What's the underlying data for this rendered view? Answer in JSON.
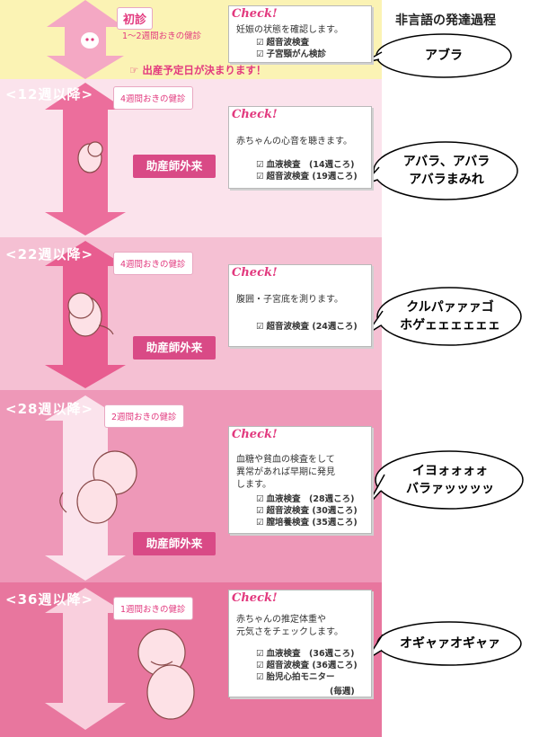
{
  "title": "非言語の発達過程",
  "first": {
    "header": "初診",
    "interval": "1〜2週間おきの健診",
    "due_note": "出産予定日が決まります！",
    "check": "Check!",
    "desc": "妊娠の状態を確認します。",
    "items": [
      "超音波検査",
      "子宮頸がん検診"
    ],
    "speech": "アブラ"
  },
  "stages": [
    {
      "header": "<12週以降>",
      "interval": "4週間おきの健診",
      "midwife": "助産師外来",
      "check": "Check!",
      "desc": "赤ちゃんの心音を聴きます。",
      "items": [
        "血液検査　(14週ころ)",
        "超音波検査 (19週ころ)"
      ],
      "speech": "アバラ、アバラ\nアバラまみれ"
    },
    {
      "header": "<22週以降>",
      "interval": "4週間おきの健診",
      "midwife": "助産師外来",
      "check": "Check!",
      "desc": "腹囲・子宮底を測ります。",
      "items": [
        "超音波検査 (24週ころ)"
      ],
      "speech": "クルパァァァゴ\nホゲェェェェェェ"
    },
    {
      "header": "<28週以降>",
      "interval": "2週間おきの健診",
      "midwife": "助産師外来",
      "check": "Check!",
      "desc": "血糖や貧血の検査をして\n異常があれば早期に発見\nします。",
      "items": [
        "血液検査　(28週ころ)",
        "超音波検査 (30週ころ)",
        "膣培養検査 (35週ころ)"
      ],
      "speech": "イヨォォォォ\nバラァッッッッ"
    },
    {
      "header": "<36週以降>",
      "interval": "1週間おきの健診",
      "check": "Check!",
      "desc": "赤ちゃんの推定体重や\n元気さをチェックします。",
      "items": [
        "血液検査　(36週ころ)",
        "超音波検査 (36週ころ)",
        "胎児心拍モニター"
      ],
      "extra": "(毎週)",
      "speech": "オギャァオギャァ"
    }
  ],
  "colors": {
    "first_bg": "#fbf3b4",
    "band_bg": [
      "#fbe3ec",
      "#f5c0d3",
      "#ee98b8",
      "#e8769e"
    ],
    "arrow": "#ec6e9c",
    "accent": "#e2397e"
  }
}
